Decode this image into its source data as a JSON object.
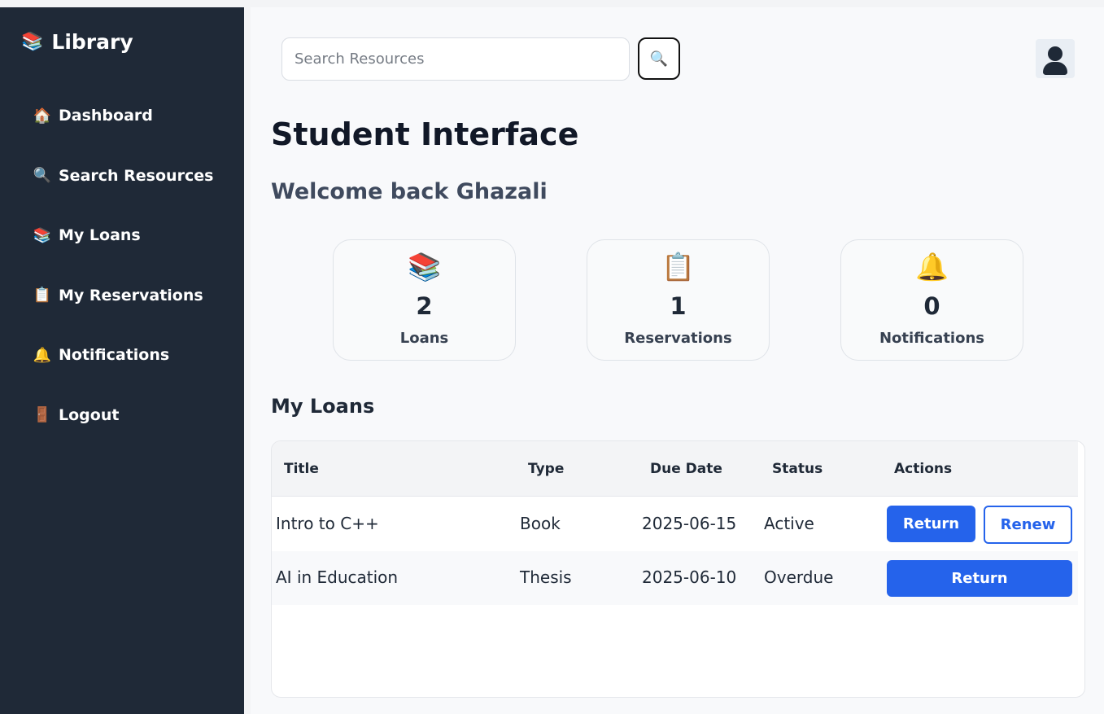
{
  "sidebar": {
    "brand": {
      "icon": "books-emoji",
      "glyph": "📚",
      "label": "Library"
    },
    "items": [
      {
        "icon": "house-icon",
        "glyph": "🏠",
        "label": "Dashboard"
      },
      {
        "icon": "magnifier-icon",
        "glyph": "🔍",
        "label": "Search Resources"
      },
      {
        "icon": "books-icon",
        "glyph": "📚",
        "label": "My Loans"
      },
      {
        "icon": "clipboard-icon",
        "glyph": "📋",
        "label": "My Reservations"
      },
      {
        "icon": "bell-icon",
        "glyph": "🔔",
        "label": "Notifications"
      },
      {
        "icon": "door-icon",
        "glyph": "🚪",
        "label": "Logout"
      }
    ]
  },
  "header": {
    "search_placeholder": "Search Resources",
    "search_button_glyph": "🔍"
  },
  "main": {
    "title": "Student Interface",
    "welcome": "Welcome back Ghazali",
    "cards": [
      {
        "icon": "books-icon",
        "glyph": "📚",
        "count": "2",
        "label": "Loans"
      },
      {
        "icon": "clipboard-icon",
        "glyph": "📋",
        "count": "1",
        "label": "Reservations"
      },
      {
        "icon": "bell-icon",
        "glyph": "🔔",
        "count": "0",
        "label": "Notifications"
      }
    ],
    "loans_title": "My Loans",
    "table": {
      "headers": [
        "Title",
        "Type",
        "Due Date",
        "Status",
        "Actions"
      ],
      "rows": [
        {
          "title": "Intro to C++",
          "type": "Book",
          "due": "2025-06-15",
          "status": "Active",
          "actions": [
            "Return",
            "Renew"
          ]
        },
        {
          "title": "AI in Education",
          "type": "Thesis",
          "due": "2025-06-10",
          "status": "Overdue",
          "actions": [
            "Return"
          ]
        }
      ]
    }
  },
  "colors": {
    "sidebar_bg": "#1f2937",
    "accent": "#2563eb",
    "main_bg": "#f8f9fb"
  }
}
